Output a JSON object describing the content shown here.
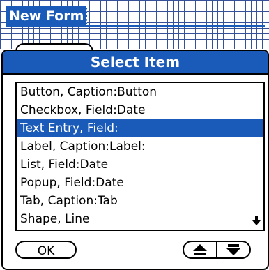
{
  "form": {
    "title": "New Form"
  },
  "dialog": {
    "title": "Select Item",
    "items": [
      {
        "label": "Button, Caption:Button",
        "selected": false
      },
      {
        "label": "Checkbox, Field:Date",
        "selected": false
      },
      {
        "label": "Text Entry, Field:",
        "selected": true
      },
      {
        "label": "Label, Caption:Label:",
        "selected": false
      },
      {
        "label": "List, Field:Date",
        "selected": false
      },
      {
        "label": "Popup, Field:Date",
        "selected": false
      },
      {
        "label": "Tab, Caption:Tab",
        "selected": false
      },
      {
        "label": "Shape, Line",
        "selected": false
      }
    ],
    "ok_label": "OK",
    "icons": {
      "scroll_down": "down-arrow-icon",
      "page_up": "page-up-icon",
      "page_down": "page-down-icon"
    },
    "colors": {
      "accent": "#1a5ab8",
      "selection_text": "#ffffff"
    }
  }
}
